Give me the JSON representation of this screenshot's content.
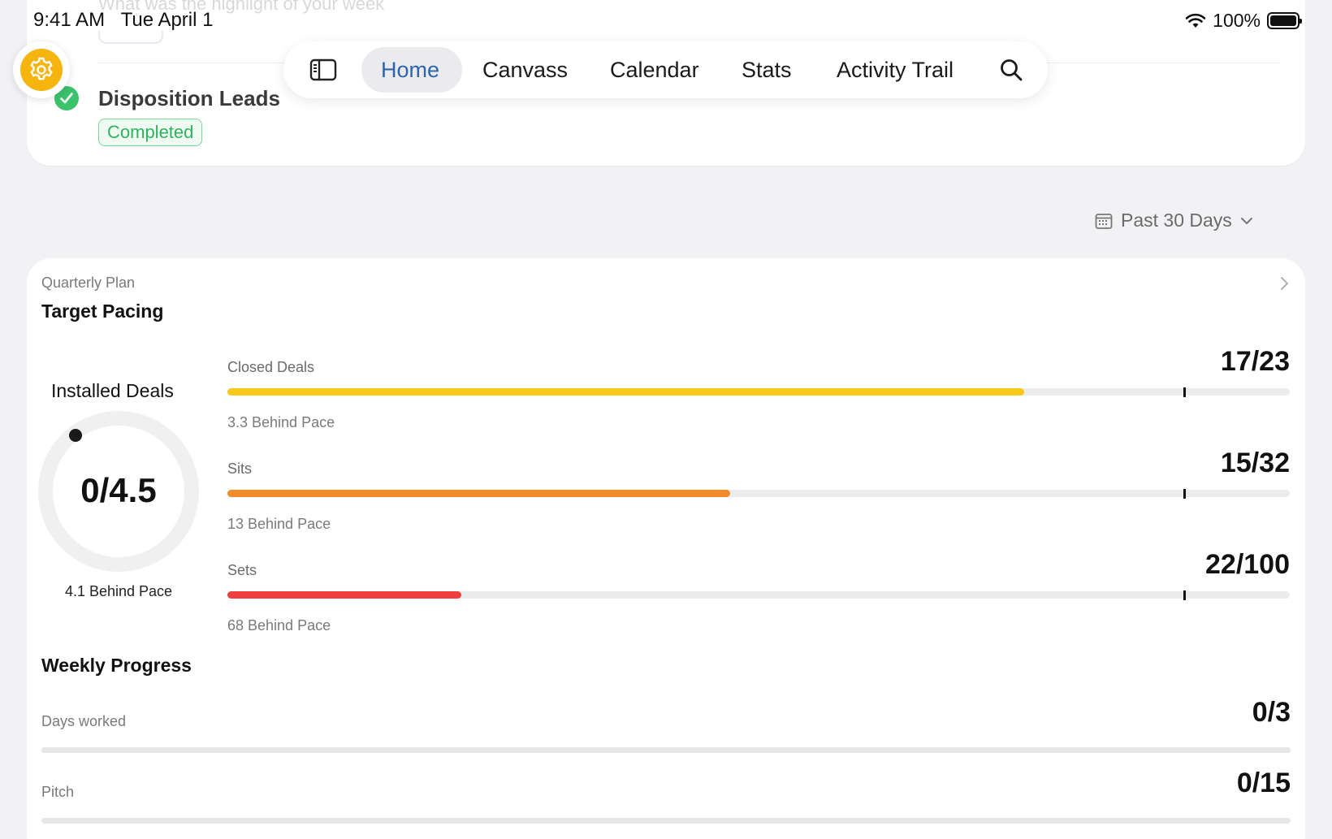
{
  "status_bar": {
    "time": "9:41 AM",
    "date": "Tue April 1",
    "battery": "100%"
  },
  "top_card": {
    "ghost_text": "What was the highlight of your week",
    "title": "Disposition Leads",
    "badge": "Completed"
  },
  "nav": {
    "items": [
      {
        "label": "Home",
        "active": true
      },
      {
        "label": "Canvass"
      },
      {
        "label": "Calendar"
      },
      {
        "label": "Stats"
      },
      {
        "label": "Activity Trail"
      }
    ]
  },
  "date_filter": {
    "label": "Past 30 Days"
  },
  "target_pacing": {
    "subtitle": "Quarterly Plan",
    "title": "Target Pacing",
    "installed": {
      "title": "Installed Deals",
      "value": "0/4.5",
      "progress": 0,
      "pace": "4.1 Behind Pace"
    },
    "metrics": [
      {
        "label": "Closed Deals",
        "value": "17/23",
        "progress": 0.75,
        "pace_marker": 0.9,
        "color": "#F8C91A",
        "pace": "3.3 Behind Pace"
      },
      {
        "label": "Sits",
        "value": "15/32",
        "progress": 0.473,
        "pace_marker": 0.9,
        "color": "#F48B2A",
        "pace": "13 Behind Pace"
      },
      {
        "label": "Sets",
        "value": "22/100",
        "progress": 0.22,
        "pace_marker": 0.9,
        "color": "#F03E3E",
        "pace": "68 Behind Pace"
      }
    ]
  },
  "weekly_progress": {
    "title": "Weekly Progress",
    "rows": [
      {
        "label": "Days worked",
        "value": "0/3",
        "progress": 0
      },
      {
        "label": "Pitch",
        "value": "0/15",
        "progress": 0
      }
    ]
  },
  "colors": {
    "accent": "#2D64AD",
    "gear": "#F6B40F",
    "success": "#3BC26B"
  }
}
